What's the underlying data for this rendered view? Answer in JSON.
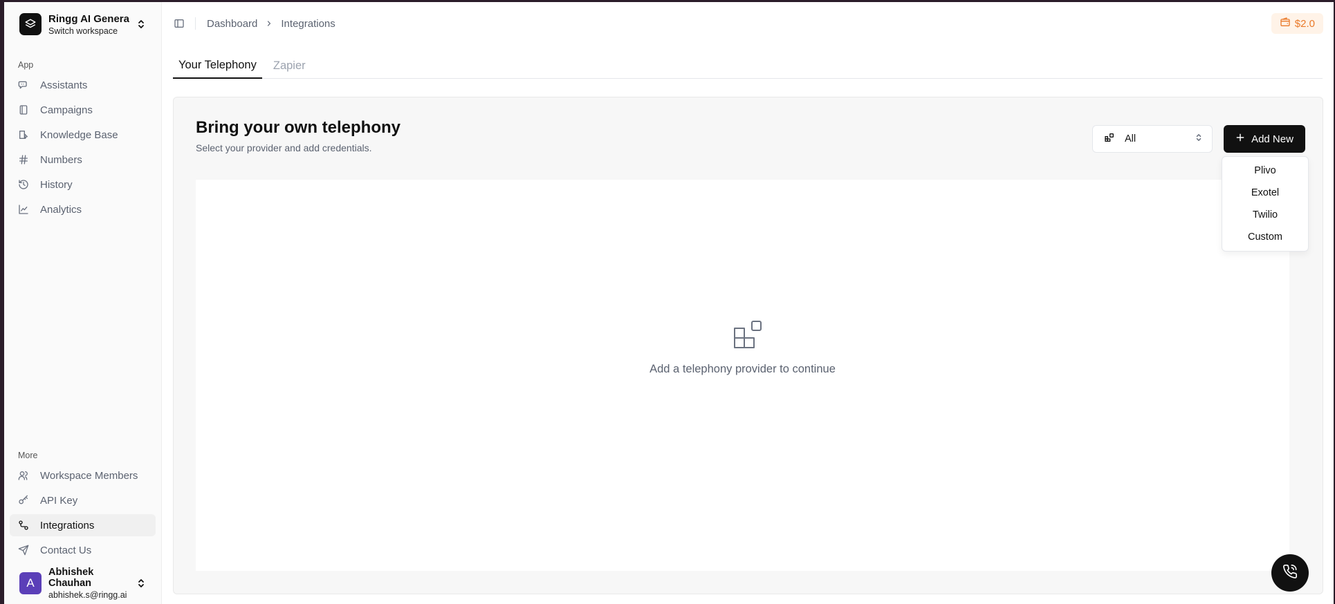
{
  "workspace": {
    "name": "Ringg AI General ...",
    "subtitle": "Switch workspace",
    "icon": "layers-icon"
  },
  "sidebar": {
    "app_label": "App",
    "app_items": [
      {
        "label": "Assistants",
        "icon": "chat-icon"
      },
      {
        "label": "Campaigns",
        "icon": "campaign-icon"
      },
      {
        "label": "Knowledge Base",
        "icon": "book-icon"
      },
      {
        "label": "Numbers",
        "icon": "hash-icon"
      },
      {
        "label": "History",
        "icon": "history-icon"
      },
      {
        "label": "Analytics",
        "icon": "chart-icon"
      }
    ],
    "more_label": "More",
    "more_items": [
      {
        "label": "Workspace Members",
        "icon": "users-icon"
      },
      {
        "label": "API Key",
        "icon": "key-icon"
      },
      {
        "label": "Integrations",
        "icon": "integrations-icon",
        "active": true
      },
      {
        "label": "Contact Us",
        "icon": "send-icon"
      }
    ]
  },
  "user": {
    "initial": "A",
    "name": "Abhishek Chauhan",
    "email": "abhishek.s@ringg.ai",
    "avatar_color": "#5b3fb8"
  },
  "breadcrumb": {
    "items": [
      "Dashboard",
      "Integrations"
    ]
  },
  "credits": {
    "value": "$2.0",
    "color": "#ea7a2a"
  },
  "tabs": [
    {
      "label": "Your Telephony",
      "active": true
    },
    {
      "label": "Zapier",
      "active": false
    }
  ],
  "panel": {
    "title": "Bring your own telephony",
    "subtitle": "Select your provider and add credentials.",
    "filter_value": "All",
    "add_label": "Add New",
    "empty_text": "Add a telephony provider to continue"
  },
  "dropdown": {
    "options": [
      "Plivo",
      "Exotel",
      "Twilio",
      "Custom"
    ]
  }
}
